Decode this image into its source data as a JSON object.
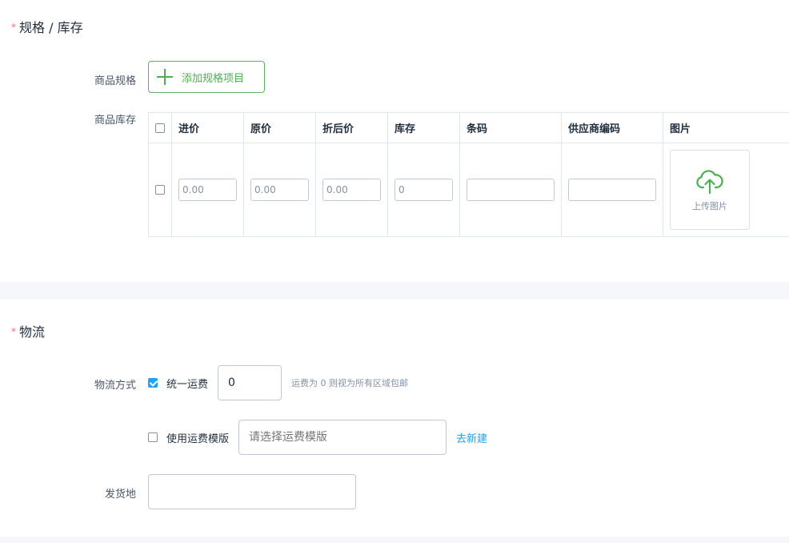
{
  "spec_section": {
    "title": "规格 / 库存",
    "required_mark": "*",
    "spec_label": "商品规格",
    "add_spec_button": "添加规格项目",
    "stock_label": "商品库存",
    "table": {
      "headers": [
        "进价",
        "原价",
        "折后价",
        "库存",
        "条码",
        "供应商编码",
        "图片"
      ],
      "row": {
        "purchase_price": "0.00",
        "original_price": "0.00",
        "discount_price": "0.00",
        "stock": "0",
        "barcode": "",
        "supplier_code": "",
        "upload_label": "上传图片"
      }
    }
  },
  "logistics_section": {
    "title": "物流",
    "required_mark": "*",
    "method_label": "物流方式",
    "unified_fee": {
      "label": "统一运费",
      "checked": true,
      "value": "0",
      "hint": "运费为 0 则视为所有区域包邮"
    },
    "template_fee": {
      "label": "使用运费模版",
      "checked": false,
      "placeholder": "请选择运费模版",
      "link": "去新建"
    },
    "origin_label": "发货地",
    "origin_value": ""
  },
  "colors": {
    "accent_blue": "#20a0ff",
    "accent_green": "#4caf50",
    "required_red": "#f56c6c"
  }
}
